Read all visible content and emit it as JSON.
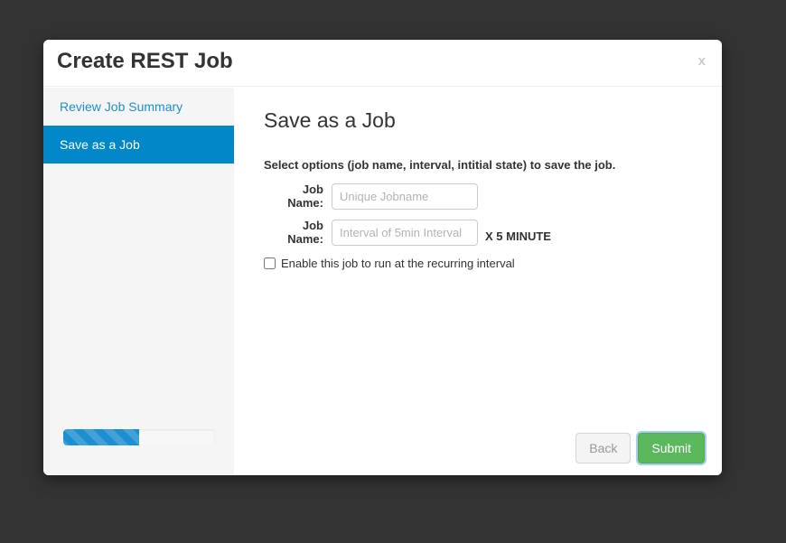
{
  "modal": {
    "title": "Create REST Job",
    "close_label": "x"
  },
  "sidebar": {
    "items": [
      {
        "label": "Review Job Summary",
        "active": false
      },
      {
        "label": "Save as a Job",
        "active": true
      }
    ],
    "progress": {
      "percent": 50,
      "fill_color": "#1c8fd0",
      "track_color": "#f7f7f7"
    }
  },
  "content": {
    "heading": "Save as a Job",
    "instructions": "Select options (job name, interval, intitial state) to save the job.",
    "fields": [
      {
        "label": "Job Name:",
        "placeholder": "Unique Jobname",
        "value": "",
        "suffix": ""
      },
      {
        "label": "Job Name:",
        "placeholder": "Interval of 5min Interval",
        "value": "",
        "suffix": "X 5 MINUTE"
      }
    ],
    "checkbox": {
      "label": "Enable this job to run at the recurring interval",
      "checked": false
    }
  },
  "footer": {
    "back_label": "Back",
    "submit_label": "Submit"
  },
  "colors": {
    "accent_blue": "#0288c8",
    "link_blue": "#1e8fcc",
    "submit_green": "#5cb85c",
    "page_background": "#333333",
    "sidebar_background": "#f5f5f5"
  }
}
